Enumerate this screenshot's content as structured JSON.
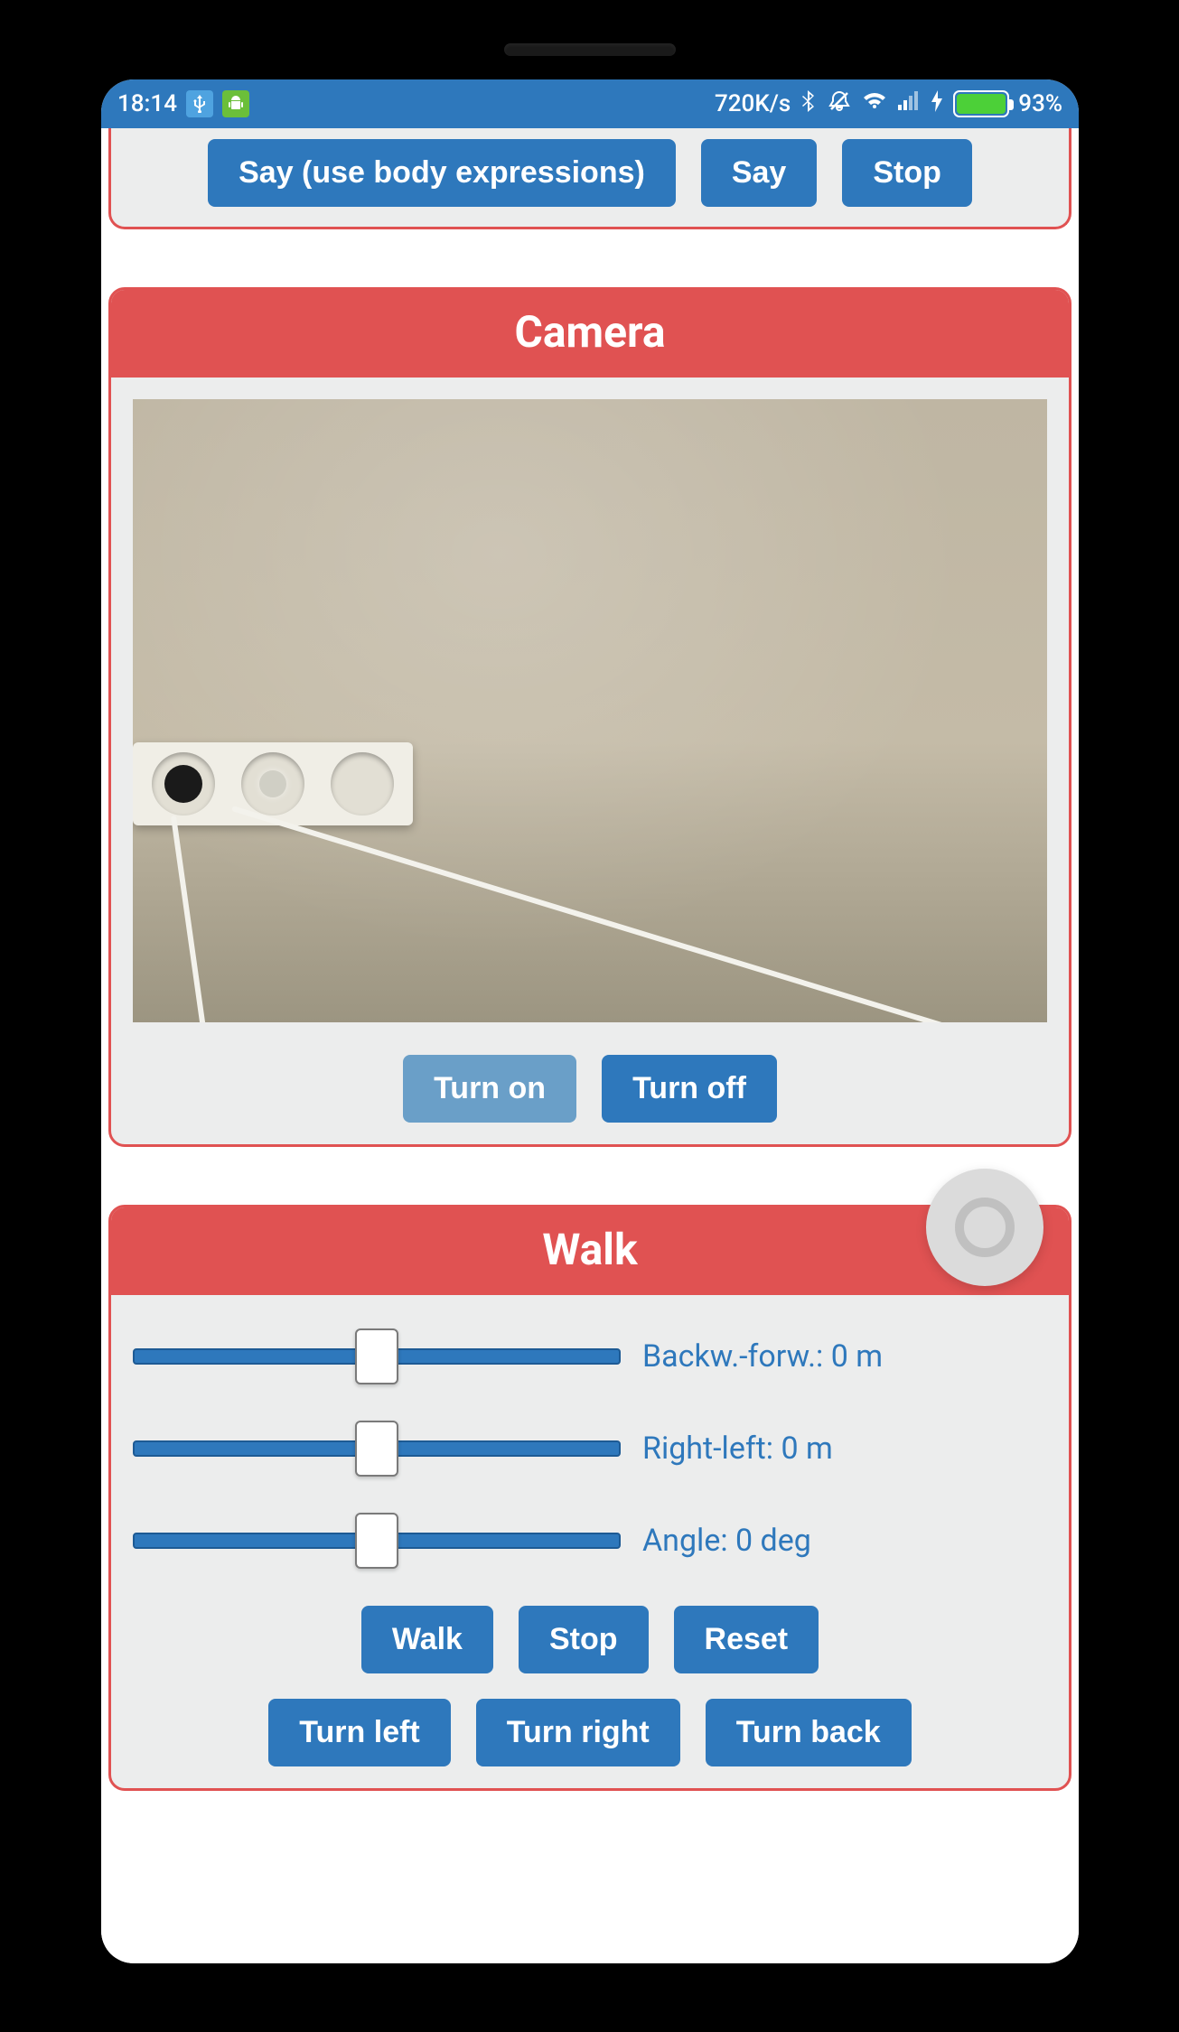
{
  "status": {
    "time": "18:14",
    "net_speed": "720K/s",
    "battery_pct": "93%"
  },
  "speech_card": {
    "say_body": "Say (use body expressions)",
    "say": "Say",
    "stop": "Stop"
  },
  "camera_card": {
    "title": "Camera",
    "turn_on": "Turn on",
    "turn_off": "Turn off"
  },
  "walk_card": {
    "title": "Walk",
    "sliders": {
      "bf_label": "Backw.-forw.: 0 m",
      "rl_label": "Right-left: 0 m",
      "angle_label": "Angle: 0 deg"
    },
    "buttons": {
      "walk": "Walk",
      "stop": "Stop",
      "reset": "Reset",
      "turn_left": "Turn left",
      "turn_right": "Turn right",
      "turn_back": "Turn back"
    }
  }
}
